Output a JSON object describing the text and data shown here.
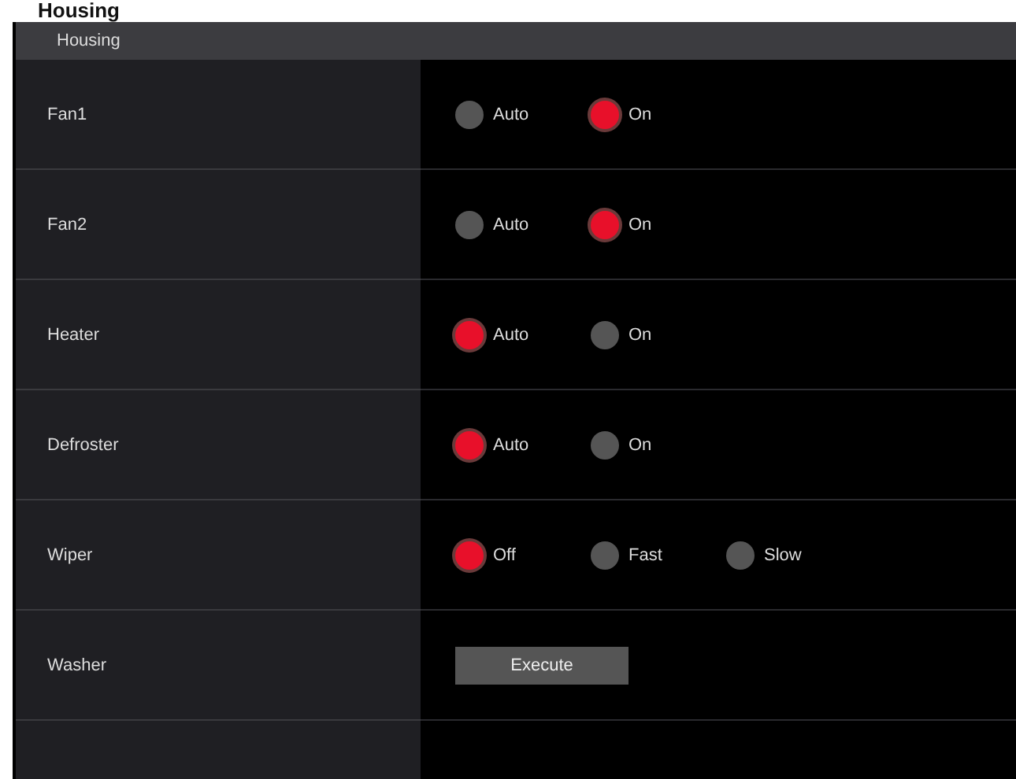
{
  "heading": "Housing",
  "section": {
    "title": "Housing"
  },
  "rows": [
    {
      "label": "Fan1",
      "kind": "radio",
      "options": [
        {
          "label": "Auto",
          "selected": false
        },
        {
          "label": "On",
          "selected": true
        }
      ]
    },
    {
      "label": "Fan2",
      "kind": "radio",
      "options": [
        {
          "label": "Auto",
          "selected": false
        },
        {
          "label": "On",
          "selected": true
        }
      ]
    },
    {
      "label": "Heater",
      "kind": "radio",
      "options": [
        {
          "label": "Auto",
          "selected": true
        },
        {
          "label": "On",
          "selected": false
        }
      ]
    },
    {
      "label": "Defroster",
      "kind": "radio",
      "options": [
        {
          "label": "Auto",
          "selected": true
        },
        {
          "label": "On",
          "selected": false
        }
      ]
    },
    {
      "label": "Wiper",
      "kind": "radio",
      "options": [
        {
          "label": "Off",
          "selected": true
        },
        {
          "label": "Fast",
          "selected": false
        },
        {
          "label": "Slow",
          "selected": false
        }
      ]
    },
    {
      "label": "Washer",
      "kind": "button",
      "button": "Execute"
    }
  ]
}
